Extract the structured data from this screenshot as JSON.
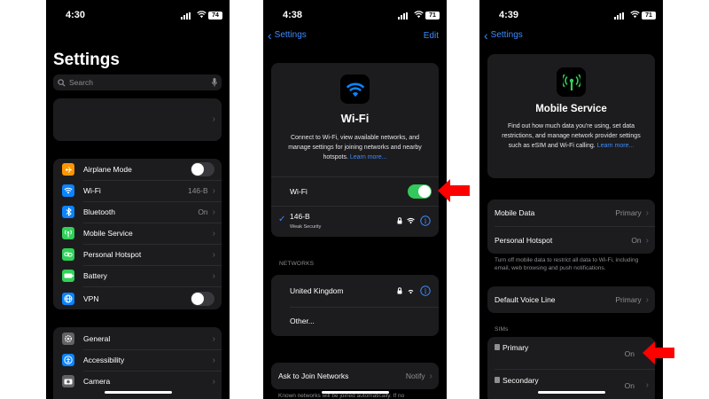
{
  "panel1": {
    "time": "4:30",
    "battery": "74",
    "title": "Settings",
    "search_placeholder": "Search",
    "items": [
      {
        "label": "Airplane Mode",
        "icon": "airplane-icon",
        "color": "#ff9500"
      },
      {
        "label": "Wi-Fi",
        "value": "146-B",
        "icon": "wifi-icon",
        "color": "#0a84ff"
      },
      {
        "label": "Bluetooth",
        "value": "On",
        "icon": "bluetooth-icon",
        "color": "#0a84ff"
      },
      {
        "label": "Mobile Service",
        "icon": "antenna-icon",
        "color": "#30d158"
      },
      {
        "label": "Personal Hotspot",
        "icon": "link-icon",
        "color": "#30d158"
      },
      {
        "label": "Battery",
        "icon": "battery-icon",
        "color": "#30d158"
      },
      {
        "label": "VPN",
        "icon": "globe-icon",
        "color": "#0a84ff"
      }
    ],
    "items2": [
      {
        "label": "General",
        "icon": "gear-icon",
        "color": "#8e8e93"
      },
      {
        "label": "Accessibility",
        "icon": "accessibility-icon",
        "color": "#0a84ff"
      },
      {
        "label": "Camera",
        "icon": "camera-icon",
        "color": "#8e8e93"
      }
    ]
  },
  "panel2": {
    "time": "4:38",
    "battery": "71",
    "back": "Settings",
    "edit": "Edit",
    "title": "Wi-Fi",
    "desc": "Connect to Wi-Fi, view available networks, and manage settings for joining networks and nearby hotspots.",
    "learn_more": "Learn more...",
    "wifi_label": "Wi-Fi",
    "connected_name": "146-B",
    "connected_sub": "Weak Security",
    "networks_header": "NETWORKS",
    "network1": "United Kingdom",
    "other": "Other...",
    "ask_join": "Ask to Join Networks",
    "ask_join_value": "Notify",
    "footer": "Known networks will be joined automatically. If no"
  },
  "panel3": {
    "time": "4:39",
    "battery": "71",
    "back": "Settings",
    "title": "Mobile Service",
    "desc": "Find out how much data you're using, set data restrictions, and manage network provider settings such as eSIM and Wi-Fi calling.",
    "learn_more": "Learn more...",
    "mobile_data": "Mobile Data",
    "mobile_data_value": "Primary",
    "hotspot": "Personal Hotspot",
    "hotspot_value": "On",
    "hotspot_note": "Turn off mobile data to restrict all data to Wi-Fi, including email, web browsing and push notifications.",
    "voice": "Default Voice Line",
    "voice_value": "Primary",
    "sims_header": "SIMs",
    "sim1": "Primary",
    "sim1_value": "On",
    "sim2": "Secondary",
    "sim2_value": "On"
  },
  "colors": {
    "accent": "#3d8bfd",
    "toggle_on": "#34c759",
    "arrow": "#ff0000"
  }
}
